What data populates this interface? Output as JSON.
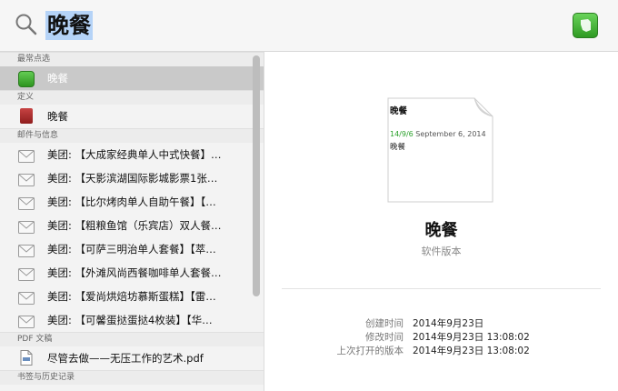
{
  "search": {
    "query": "晚餐"
  },
  "sections": {
    "top_hit": "最常点选",
    "definition": "定义",
    "mail": "邮件与信息",
    "pdf": "PDF 文稿",
    "bookmarks": "书签与历史记录"
  },
  "top_hit": {
    "label": "晚餐"
  },
  "definition": {
    "label": "晚餐"
  },
  "mail_items": [
    "美团: 【大成家经典单人中式快餐】…",
    "美团: 【天影滨湖国际影城影票1张…",
    "美团: 【比尔烤肉单人自助午餐】【…",
    "美团: 【粗粮鱼馆（乐宾店）双人餐…",
    "美团: 【可萨三明治单人套餐】【萃…",
    "美团: 【外滩风尚西餐咖啡单人套餐…",
    "美团: 【爱尚烘焙坊慕斯蛋糕】【雷…",
    "美团: 【可馨蛋挞蛋挞4枚装】【华…"
  ],
  "pdf": {
    "label": "尽管去做——无压工作的艺术.pdf"
  },
  "preview": {
    "doc_title": "晚餐",
    "doc_date_short": "14/9/6",
    "doc_date_long": "September 6, 2014",
    "doc_body": "晚餐",
    "title": "晚餐",
    "subtitle": "软件版本",
    "meta": [
      {
        "key": "创建时间",
        "value": "2014年9月23日"
      },
      {
        "key": "修改时间",
        "value": "2014年9月23日 13:08:02"
      },
      {
        "key": "上次打开的版本",
        "value": "2014年9月23日 13:08:02"
      }
    ]
  },
  "colors": {
    "selection": "#b5d3f7",
    "evernote_green": "#3fae2f",
    "row_selected": "#c9c9c9"
  },
  "icons": {
    "search": "search-icon",
    "app": "evernote-icon",
    "mail": "envelope-icon",
    "dict": "dictionary-icon",
    "pdf": "pdf-icon"
  }
}
